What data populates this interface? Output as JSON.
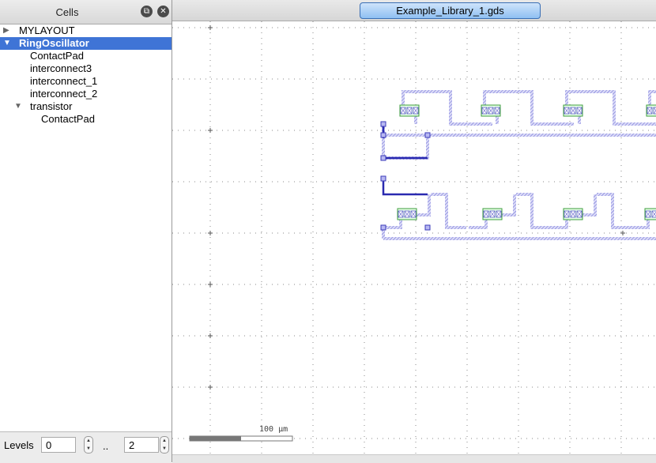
{
  "panel": {
    "title": "Cells",
    "tree": [
      {
        "label": "MYLAYOUT",
        "expander": "collapsed"
      },
      {
        "label": "RingOscillator",
        "expander": "expanded",
        "selected": true
      },
      {
        "label": "ContactPad"
      },
      {
        "label": "interconnect3"
      },
      {
        "label": "interconnect_1"
      },
      {
        "label": "interconnect_2"
      },
      {
        "label": "transistor",
        "expander": "expanded"
      },
      {
        "label": "ContactPad"
      }
    ],
    "levels": {
      "label": "Levels",
      "from": "0",
      "separator": "..",
      "to": "2"
    }
  },
  "tab": {
    "label": "Example_Library_1.gds"
  },
  "view": {
    "scale_label": "100 µm"
  },
  "colors": {
    "selection": "#3f74d6",
    "wire": "#6a6ad8",
    "contact": "#3d9c3d",
    "tab_blue": "#8fc0f2"
  }
}
